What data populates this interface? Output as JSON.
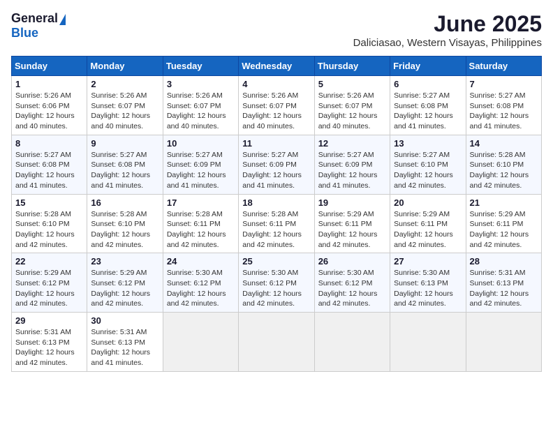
{
  "logo": {
    "general": "General",
    "blue": "Blue"
  },
  "title": "June 2025",
  "subtitle": "Daliciasao, Western Visayas, Philippines",
  "weekdays": [
    "Sunday",
    "Monday",
    "Tuesday",
    "Wednesday",
    "Thursday",
    "Friday",
    "Saturday"
  ],
  "weeks": [
    [
      {
        "day": "1",
        "sunrise": "5:26 AM",
        "sunset": "6:06 PM",
        "daylight": "12 hours and 40 minutes."
      },
      {
        "day": "2",
        "sunrise": "5:26 AM",
        "sunset": "6:07 PM",
        "daylight": "12 hours and 40 minutes."
      },
      {
        "day": "3",
        "sunrise": "5:26 AM",
        "sunset": "6:07 PM",
        "daylight": "12 hours and 40 minutes."
      },
      {
        "day": "4",
        "sunrise": "5:26 AM",
        "sunset": "6:07 PM",
        "daylight": "12 hours and 40 minutes."
      },
      {
        "day": "5",
        "sunrise": "5:26 AM",
        "sunset": "6:07 PM",
        "daylight": "12 hours and 40 minutes."
      },
      {
        "day": "6",
        "sunrise": "5:27 AM",
        "sunset": "6:08 PM",
        "daylight": "12 hours and 41 minutes."
      },
      {
        "day": "7",
        "sunrise": "5:27 AM",
        "sunset": "6:08 PM",
        "daylight": "12 hours and 41 minutes."
      }
    ],
    [
      {
        "day": "8",
        "sunrise": "5:27 AM",
        "sunset": "6:08 PM",
        "daylight": "12 hours and 41 minutes."
      },
      {
        "day": "9",
        "sunrise": "5:27 AM",
        "sunset": "6:08 PM",
        "daylight": "12 hours and 41 minutes."
      },
      {
        "day": "10",
        "sunrise": "5:27 AM",
        "sunset": "6:09 PM",
        "daylight": "12 hours and 41 minutes."
      },
      {
        "day": "11",
        "sunrise": "5:27 AM",
        "sunset": "6:09 PM",
        "daylight": "12 hours and 41 minutes."
      },
      {
        "day": "12",
        "sunrise": "5:27 AM",
        "sunset": "6:09 PM",
        "daylight": "12 hours and 41 minutes."
      },
      {
        "day": "13",
        "sunrise": "5:27 AM",
        "sunset": "6:10 PM",
        "daylight": "12 hours and 42 minutes."
      },
      {
        "day": "14",
        "sunrise": "5:28 AM",
        "sunset": "6:10 PM",
        "daylight": "12 hours and 42 minutes."
      }
    ],
    [
      {
        "day": "15",
        "sunrise": "5:28 AM",
        "sunset": "6:10 PM",
        "daylight": "12 hours and 42 minutes."
      },
      {
        "day": "16",
        "sunrise": "5:28 AM",
        "sunset": "6:10 PM",
        "daylight": "12 hours and 42 minutes."
      },
      {
        "day": "17",
        "sunrise": "5:28 AM",
        "sunset": "6:11 PM",
        "daylight": "12 hours and 42 minutes."
      },
      {
        "day": "18",
        "sunrise": "5:28 AM",
        "sunset": "6:11 PM",
        "daylight": "12 hours and 42 minutes."
      },
      {
        "day": "19",
        "sunrise": "5:29 AM",
        "sunset": "6:11 PM",
        "daylight": "12 hours and 42 minutes."
      },
      {
        "day": "20",
        "sunrise": "5:29 AM",
        "sunset": "6:11 PM",
        "daylight": "12 hours and 42 minutes."
      },
      {
        "day": "21",
        "sunrise": "5:29 AM",
        "sunset": "6:11 PM",
        "daylight": "12 hours and 42 minutes."
      }
    ],
    [
      {
        "day": "22",
        "sunrise": "5:29 AM",
        "sunset": "6:12 PM",
        "daylight": "12 hours and 42 minutes."
      },
      {
        "day": "23",
        "sunrise": "5:29 AM",
        "sunset": "6:12 PM",
        "daylight": "12 hours and 42 minutes."
      },
      {
        "day": "24",
        "sunrise": "5:30 AM",
        "sunset": "6:12 PM",
        "daylight": "12 hours and 42 minutes."
      },
      {
        "day": "25",
        "sunrise": "5:30 AM",
        "sunset": "6:12 PM",
        "daylight": "12 hours and 42 minutes."
      },
      {
        "day": "26",
        "sunrise": "5:30 AM",
        "sunset": "6:12 PM",
        "daylight": "12 hours and 42 minutes."
      },
      {
        "day": "27",
        "sunrise": "5:30 AM",
        "sunset": "6:13 PM",
        "daylight": "12 hours and 42 minutes."
      },
      {
        "day": "28",
        "sunrise": "5:31 AM",
        "sunset": "6:13 PM",
        "daylight": "12 hours and 42 minutes."
      }
    ],
    [
      {
        "day": "29",
        "sunrise": "5:31 AM",
        "sunset": "6:13 PM",
        "daylight": "12 hours and 42 minutes."
      },
      {
        "day": "30",
        "sunrise": "5:31 AM",
        "sunset": "6:13 PM",
        "daylight": "12 hours and 41 minutes."
      },
      null,
      null,
      null,
      null,
      null
    ]
  ],
  "labels": {
    "sunrise": "Sunrise:",
    "sunset": "Sunset:",
    "daylight": "Daylight:"
  }
}
